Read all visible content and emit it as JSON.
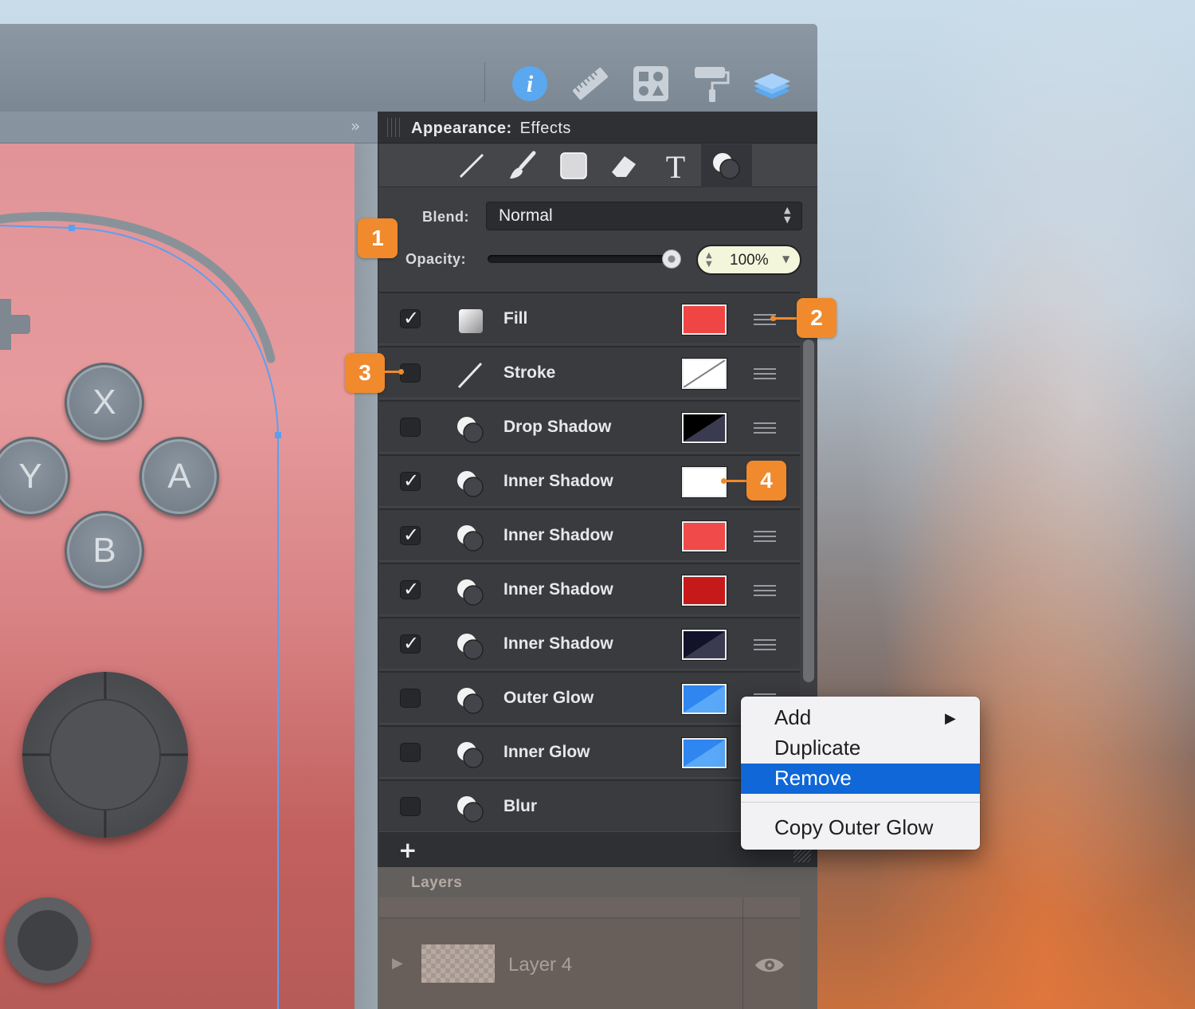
{
  "panel": {
    "title_bold": "Appearance:",
    "title_mode": "Effects"
  },
  "blend": {
    "label": "Blend:",
    "value": "Normal"
  },
  "opacity": {
    "label": "Opacity:",
    "value": "100%",
    "level": 1.0
  },
  "effects": [
    {
      "label": "Fill",
      "checked": true,
      "icon": "fill-icon",
      "swatch": "#f04545"
    },
    {
      "label": "Stroke",
      "checked": false,
      "icon": "stroke-icon",
      "swatch": "none"
    },
    {
      "label": "Drop Shadow",
      "checked": false,
      "icon": "effect-icon",
      "swatch": "#000000"
    },
    {
      "label": "Inner Shadow",
      "checked": true,
      "icon": "effect-icon",
      "swatch": "#ffffff"
    },
    {
      "label": "Inner Shadow",
      "checked": true,
      "icon": "effect-icon",
      "swatch": "#f04a4a"
    },
    {
      "label": "Inner Shadow",
      "checked": true,
      "icon": "effect-icon",
      "swatch": "#c61a1a"
    },
    {
      "label": "Inner Shadow",
      "checked": true,
      "icon": "effect-icon",
      "swatch": "#12122a"
    },
    {
      "label": "Outer Glow",
      "checked": false,
      "icon": "effect-icon",
      "swatch": "#2f86f0"
    },
    {
      "label": "Inner Glow",
      "checked": false,
      "icon": "effect-icon",
      "swatch": "#2f86f0"
    },
    {
      "label": "Blur",
      "checked": false,
      "icon": "effect-icon",
      "swatch": ""
    }
  ],
  "add_button": "+",
  "context_menu": {
    "items": [
      "Add",
      "Duplicate",
      "Remove",
      "Copy Outer Glow"
    ],
    "highlighted": "Remove"
  },
  "layers": {
    "title": "Layers",
    "rows": [
      {
        "name": "Layer 4"
      }
    ]
  },
  "canvas": {
    "buttons": [
      "X",
      "Y",
      "A",
      "B"
    ]
  },
  "callouts": [
    "1",
    "2",
    "3",
    "4"
  ],
  "toolbar_icons": [
    "info-icon",
    "ruler-icon",
    "shapes-icon",
    "paint-roller-icon",
    "layers-icon"
  ],
  "tool_tabs": [
    "line-tool-icon",
    "brush-tool-icon",
    "shape-tool-icon",
    "eraser-tool-icon",
    "text-tool-icon",
    "effects-tool-icon"
  ],
  "colors": {
    "accent_orange": "#f08a2c",
    "menu_highlight": "#0f67d8",
    "info_blue": "#5aa8f0"
  }
}
